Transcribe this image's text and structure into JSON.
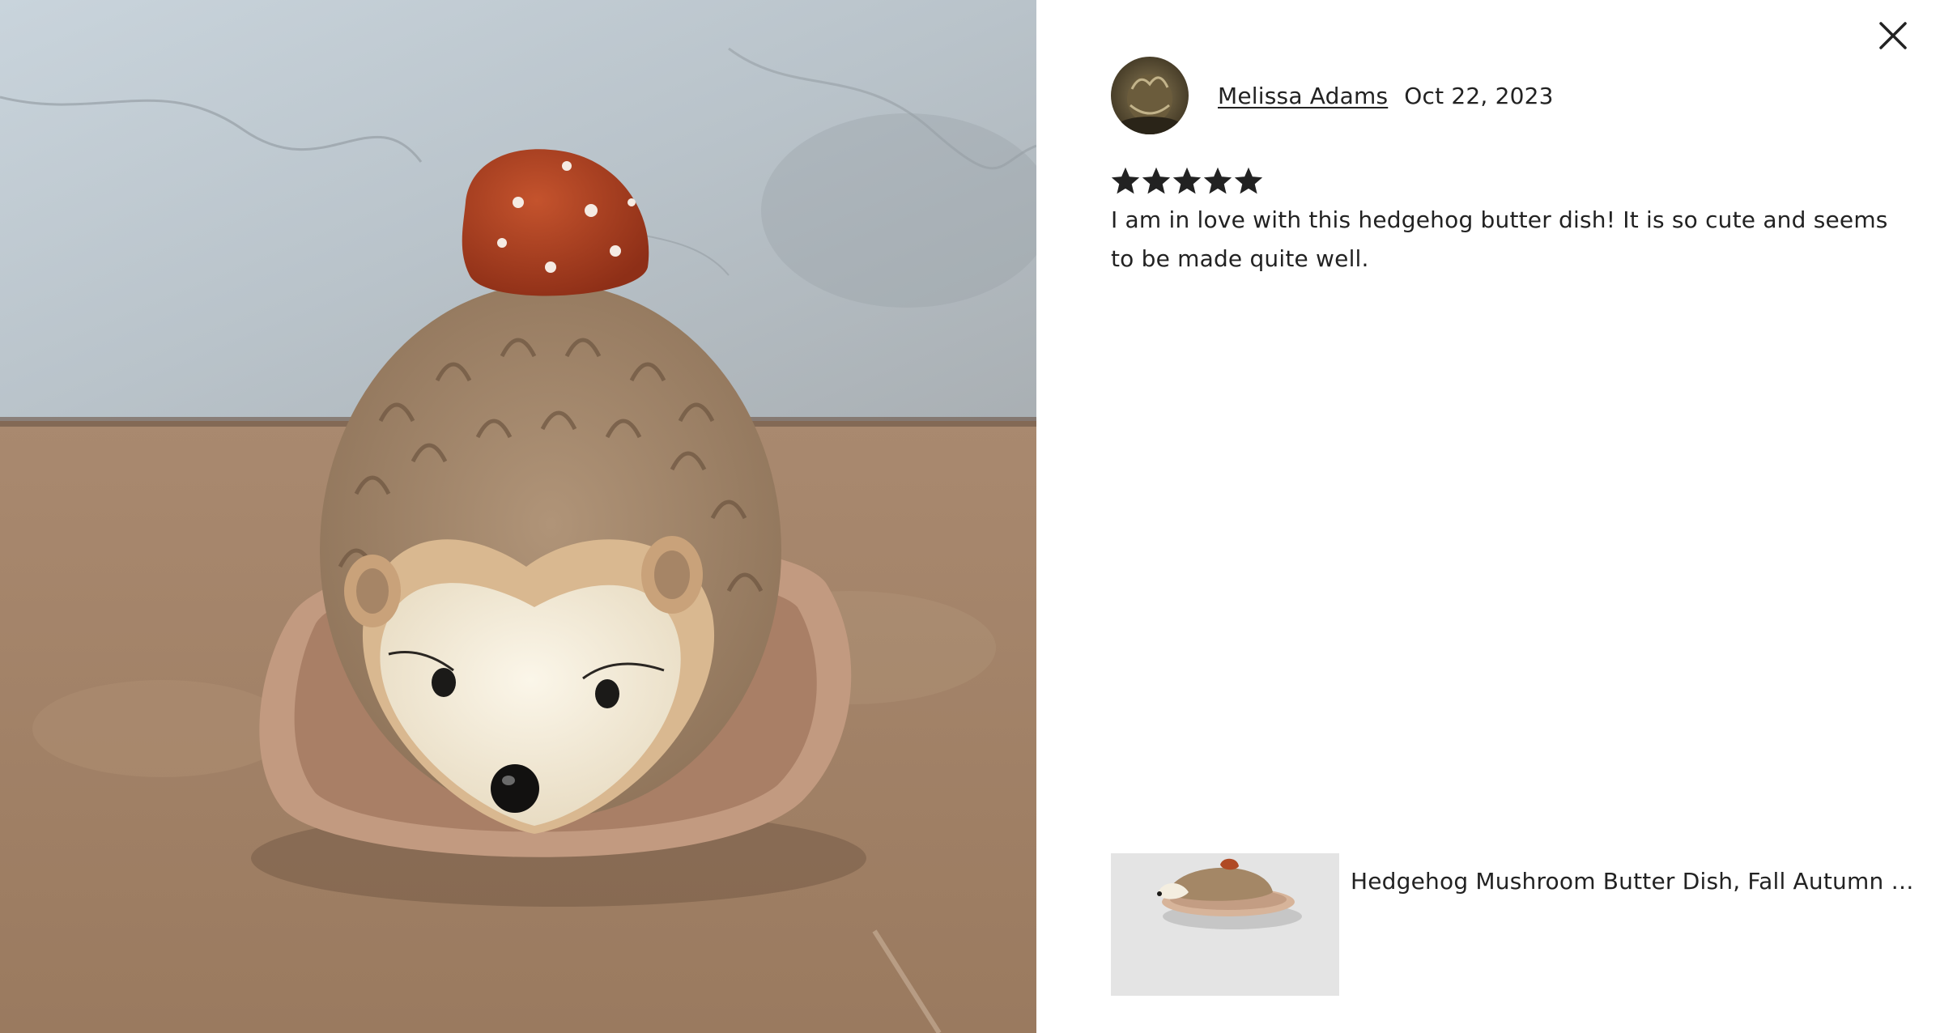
{
  "review": {
    "reviewer_name": "Melissa Adams",
    "date": "Oct 22, 2023",
    "rating": 5,
    "rating_max": 5,
    "text": "I am in love with this hedgehog butter dish! It is so cute and seems to be made quite well."
  },
  "product": {
    "title": "Hedgehog Mushroom Butter Dish, Fall Autumn Ho..."
  },
  "icons": {
    "close": "close-icon",
    "star": "star-icon"
  },
  "colors": {
    "text": "#222222",
    "star": "#222222",
    "thumb_bg": "#e4e4e4"
  }
}
